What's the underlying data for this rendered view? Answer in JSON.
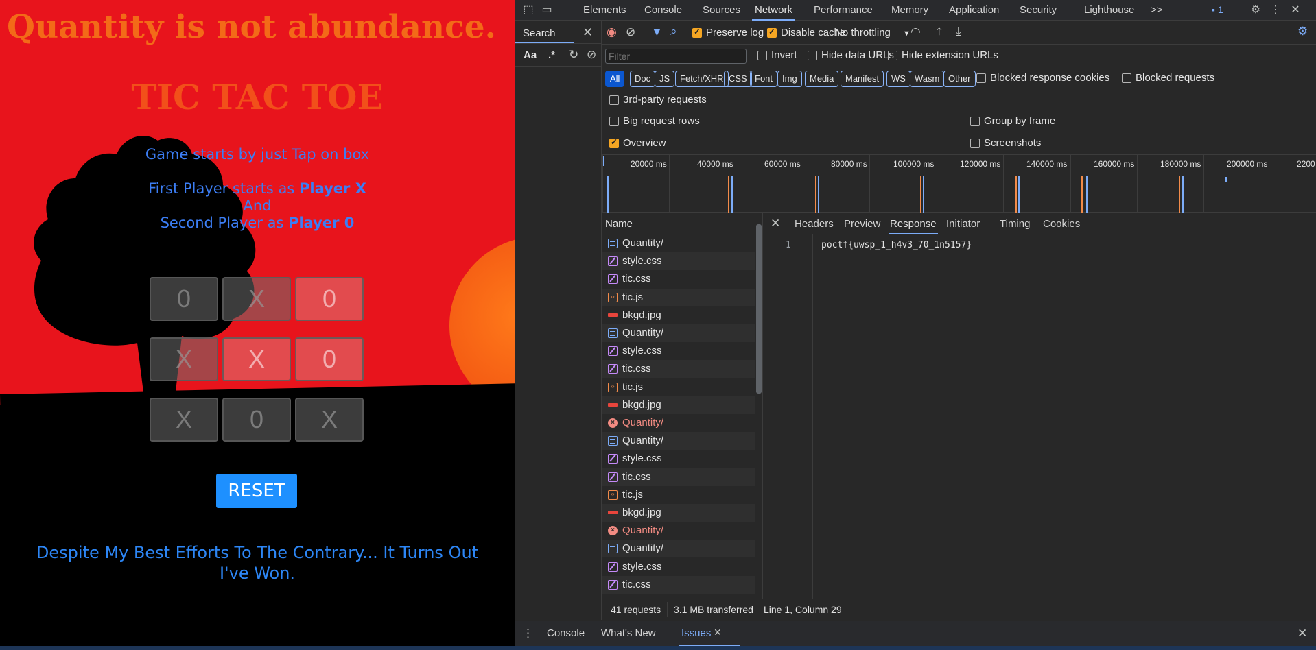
{
  "game": {
    "quote": "Quantity is not abundance.",
    "title": "TIC TAC TOE",
    "intro": "Game starts by just Tap on box",
    "line1_prefix": "First Player starts as ",
    "line1_player": "Player X",
    "line2": "And",
    "line3_prefix": "Second Player as ",
    "line3_player": "Player 0",
    "board": [
      "0",
      "X",
      "0",
      "X",
      "X",
      "0",
      "X",
      "0",
      "X"
    ],
    "reset_label": "RESET",
    "result_line1": "Despite My Best Efforts To The Contrary... It Turns Out",
    "result_line2": "I've Won."
  },
  "devtools": {
    "tabs": [
      "Elements",
      "Console",
      "Sources",
      "Network",
      "Performance",
      "Memory",
      "Application",
      "Security",
      "Lighthouse"
    ],
    "active_tab": "Network",
    "more_tabs": ">>",
    "issues_count": "1",
    "search_panel": {
      "title": "Search",
      "case_toggle": "Aa",
      "regex_toggle": ".*"
    },
    "toolbar": {
      "preserve_log": "Preserve log",
      "disable_cache": "Disable cache",
      "throttling": "No throttling"
    },
    "filter": {
      "placeholder": "Filter",
      "invert": "Invert",
      "hide_data_urls": "Hide data URLs",
      "hide_extension_urls": "Hide extension URLs",
      "types": [
        "All",
        "Doc",
        "JS",
        "Fetch/XHR",
        "CSS",
        "Font",
        "Img",
        "Media",
        "Manifest",
        "WS",
        "Wasm",
        "Other"
      ],
      "blocked_response_cookies": "Blocked response cookies",
      "blocked_requests": "Blocked requests",
      "third_party": "3rd-party requests"
    },
    "options": {
      "big_request_rows": "Big request rows",
      "group_by_frame": "Group by frame",
      "overview": "Overview",
      "screenshots": "Screenshots"
    },
    "timeline_labels": [
      "20000 ms",
      "40000 ms",
      "60000 ms",
      "80000 ms",
      "100000 ms",
      "120000 ms",
      "140000 ms",
      "160000 ms",
      "180000 ms",
      "200000 ms",
      "2200"
    ],
    "name_header": "Name",
    "requests": [
      {
        "name": "Quantity/",
        "type": "doc"
      },
      {
        "name": "style.css",
        "type": "css"
      },
      {
        "name": "tic.css",
        "type": "css"
      },
      {
        "name": "tic.js",
        "type": "js"
      },
      {
        "name": "bkgd.jpg",
        "type": "img"
      },
      {
        "name": "Quantity/",
        "type": "doc"
      },
      {
        "name": "style.css",
        "type": "css"
      },
      {
        "name": "tic.css",
        "type": "css"
      },
      {
        "name": "tic.js",
        "type": "js"
      },
      {
        "name": "bkgd.jpg",
        "type": "img"
      },
      {
        "name": "Quantity/",
        "type": "err"
      },
      {
        "name": "Quantity/",
        "type": "doc"
      },
      {
        "name": "style.css",
        "type": "css"
      },
      {
        "name": "tic.css",
        "type": "css"
      },
      {
        "name": "tic.js",
        "type": "js"
      },
      {
        "name": "bkgd.jpg",
        "type": "img"
      },
      {
        "name": "Quantity/",
        "type": "err"
      },
      {
        "name": "Quantity/",
        "type": "doc"
      },
      {
        "name": "style.css",
        "type": "css"
      },
      {
        "name": "tic.css",
        "type": "css"
      }
    ],
    "detail_tabs": [
      "Headers",
      "Preview",
      "Response",
      "Initiator",
      "Timing",
      "Cookies"
    ],
    "active_detail_tab": "Response",
    "response": {
      "line_number": "1",
      "content": "poctf{uwsp_1_h4v3_70_1n5157}"
    },
    "status": {
      "requests": "41 requests",
      "transferred": "3.1 MB transferred",
      "cursor": "Line 1, Column 29"
    },
    "drawer_tabs": [
      "Console",
      "What's New",
      "Issues"
    ],
    "active_drawer_tab": "Issues"
  }
}
